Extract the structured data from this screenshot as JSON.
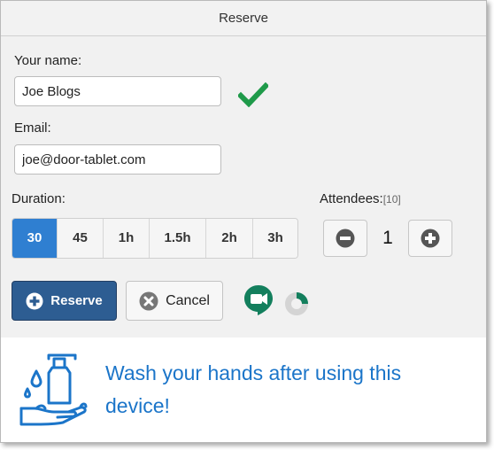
{
  "dialog": {
    "title": "Reserve"
  },
  "form": {
    "name_label": "Your name:",
    "name_value": "Joe Blogs",
    "email_label": "Email:",
    "email_value": "joe@door-tablet.com",
    "duration_label": "Duration:",
    "durations": [
      "30",
      "45",
      "1h",
      "1.5h",
      "2h",
      "3h"
    ],
    "duration_selected": "30",
    "attendees_label": "Attendees:",
    "attendees_max": "[10]",
    "attendees_count": "1"
  },
  "actions": {
    "reserve_label": "Reserve",
    "cancel_label": "Cancel"
  },
  "notice": {
    "text": "Wash your hands after using this device!"
  },
  "icons": {
    "valid": "check-icon",
    "decrement": "minus-circle-icon",
    "increment": "plus-circle-icon",
    "reserve": "plus-circle-icon",
    "cancel": "x-circle-icon",
    "meeting": "google-meet-icon",
    "loading": "progress-spinner-icon",
    "notice": "hand-wash-icon"
  },
  "colors": {
    "accent": "#2f7fd1",
    "reserve_button": "#2d5d92",
    "valid_check": "#1f9a4a",
    "meet_green": "#137f5d",
    "notice_text": "#1b75c9"
  }
}
